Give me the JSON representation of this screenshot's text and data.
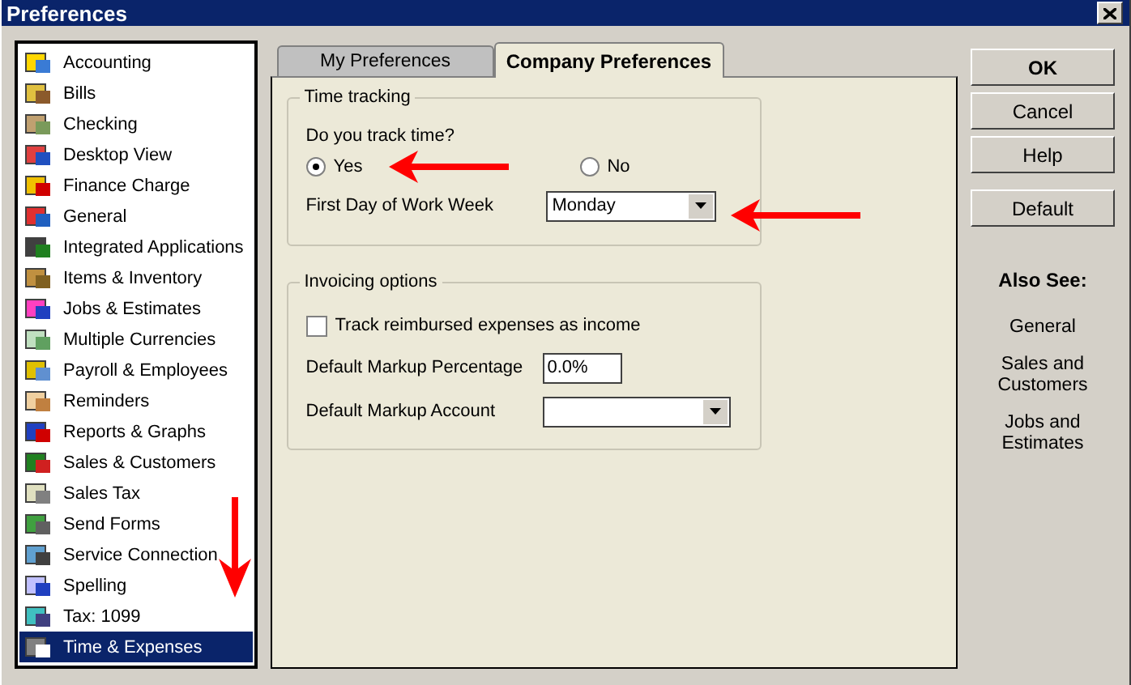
{
  "window": {
    "title": "Preferences"
  },
  "sidebar": {
    "items": [
      {
        "label": "Accounting",
        "selected": false
      },
      {
        "label": "Bills",
        "selected": false
      },
      {
        "label": "Checking",
        "selected": false
      },
      {
        "label": "Desktop View",
        "selected": false
      },
      {
        "label": "Finance Charge",
        "selected": false
      },
      {
        "label": "General",
        "selected": false
      },
      {
        "label": "Integrated Applications",
        "selected": false
      },
      {
        "label": "Items & Inventory",
        "selected": false
      },
      {
        "label": "Jobs & Estimates",
        "selected": false
      },
      {
        "label": "Multiple Currencies",
        "selected": false
      },
      {
        "label": "Payroll & Employees",
        "selected": false
      },
      {
        "label": "Reminders",
        "selected": false
      },
      {
        "label": "Reports & Graphs",
        "selected": false
      },
      {
        "label": "Sales & Customers",
        "selected": false
      },
      {
        "label": "Sales Tax",
        "selected": false
      },
      {
        "label": "Send Forms",
        "selected": false
      },
      {
        "label": "Service Connection",
        "selected": false
      },
      {
        "label": "Spelling",
        "selected": false
      },
      {
        "label": "Tax: 1099",
        "selected": false
      },
      {
        "label": "Time & Expenses",
        "selected": true
      }
    ]
  },
  "tabs": [
    {
      "label": "My Preferences",
      "selected": false
    },
    {
      "label": "Company Preferences",
      "selected": true
    }
  ],
  "time_tracking": {
    "title": "Time tracking",
    "question": "Do you track time?",
    "options": [
      {
        "label": "Yes",
        "selected": true
      },
      {
        "label": "No",
        "selected": false
      }
    ],
    "first_day": {
      "label": "First Day of Work Week",
      "value": "Monday"
    }
  },
  "invoicing": {
    "title": "Invoicing options",
    "track_reimbursed": {
      "label": "Track reimbursed expenses as income",
      "checked": false
    },
    "markup_percentage": {
      "label": "Default Markup Percentage",
      "value": "0.0%"
    },
    "markup_account": {
      "label": "Default Markup Account"
    }
  },
  "buttons": [
    {
      "label": "OK",
      "primary": true
    },
    {
      "label": "Cancel",
      "primary": false
    },
    {
      "label": "Help",
      "primary": false
    }
  ],
  "default_button": {
    "label": "Default"
  },
  "also_see": {
    "title": "Also See:",
    "links": [
      "General",
      "Sales and Customers",
      "Jobs and Estimates"
    ]
  }
}
